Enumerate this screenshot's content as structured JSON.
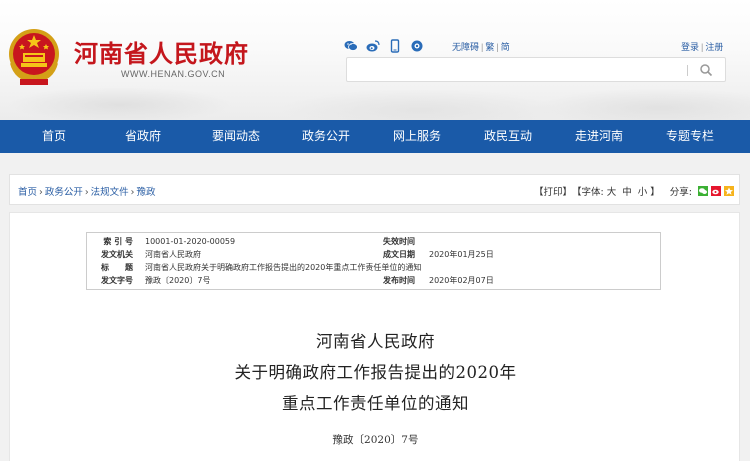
{
  "header": {
    "title": "河南省人民政府",
    "url": "WWW.HENAN.GOV.CN",
    "accessibility_label": "无障碍",
    "traditional_label": "繁",
    "simplified_label": "简",
    "login_label": "登录",
    "register_label": "注册",
    "search_placeholder": "",
    "social_icons": [
      "wechat-icon",
      "weibo-icon",
      "mobile-icon",
      "broadcast-icon"
    ]
  },
  "nav": {
    "items": [
      "首页",
      "省政府",
      "要闻动态",
      "政务公开",
      "网上服务",
      "政民互动",
      "走进河南",
      "专题专栏"
    ]
  },
  "breadcrumb": {
    "items": [
      "首页",
      "政务公开",
      "法规文件",
      "豫政"
    ],
    "separator": "›"
  },
  "tools": {
    "print_label": "【打印】",
    "font_label": "【字体:",
    "font_sizes": [
      "大",
      "中",
      "小"
    ],
    "font_close": "】",
    "share_label": "分享:"
  },
  "meta": {
    "index_label": "索 引 号",
    "index_value": "10001-01-2020-00059",
    "invalid_label": "失效时间",
    "invalid_value": "",
    "issuer_label": "发文机关",
    "issuer_value": "河南省人民政府",
    "created_label": "成文日期",
    "created_value": "2020年01月25日",
    "title_label": "标　　题",
    "title_value": "河南省人民政府关于明确政府工作报告提出的2020年重点工作责任单位的通知",
    "docno_label": "发文字号",
    "docno_value": "豫政〔2020〕7号",
    "published_label": "发布时间",
    "published_value": "2020年02月07日"
  },
  "document": {
    "title_lines": [
      "河南省人民政府",
      "关于明确政府工作报告提出的2020年",
      "重点工作责任单位的通知"
    ],
    "number": "豫政〔2020〕7号"
  },
  "colors": {
    "brand_red": "#c4161c",
    "nav_blue": "#1a5aa8",
    "link_blue": "#2a5ea4"
  }
}
